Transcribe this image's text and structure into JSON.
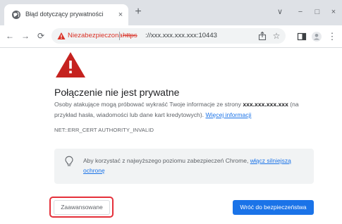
{
  "browser": {
    "tab": {
      "title": "Błąd dotyczący prywatności",
      "close_glyph": "×",
      "favicon": "globe-icon"
    },
    "new_tab_glyph": "+",
    "window_controls": {
      "dropdown": "∨",
      "minimize": "−",
      "maximize": "□",
      "close": "×"
    },
    "nav": {
      "back": "←",
      "forward": "→",
      "reload": "⟳"
    },
    "omnibox": {
      "security_label": "Niezabezpieczona",
      "url_scheme": "https",
      "url_rest": "://xxx.xxx.xxx.xxx:10443"
    },
    "icons": {
      "share": "share-icon",
      "bookmark": "☆",
      "sidepanel": "sidepanel-icon",
      "profile": "profile-icon",
      "menu": "⋮"
    }
  },
  "page": {
    "heading": "Połączenie nie jest prywatne",
    "description": {
      "before": "Osoby atakujące mogą próbować wykraść Twoje informacje ze strony ",
      "host": "xxx.xxx.xxx.xxx",
      "after": " (na przykład hasła, wiadomości lub dane kart kredytowych). ",
      "link": "Więcej informacji"
    },
    "error_code": "NET::ERR_CERT AUTHORITY_INVALID",
    "info": {
      "text": "Aby korzystać z najwyższego poziomu zabezpieczeń Chrome, ",
      "link": "włącz silniejszą ochronę"
    },
    "advanced_button": "Zaawansowane",
    "back_button": "Wróć do bezpieczeństwa"
  },
  "colors": {
    "danger": "#d93025",
    "link": "#1a73e8",
    "primary_button": "#1a73e8",
    "highlight": "#e5303a",
    "warning_triangle": "#c5221f"
  }
}
